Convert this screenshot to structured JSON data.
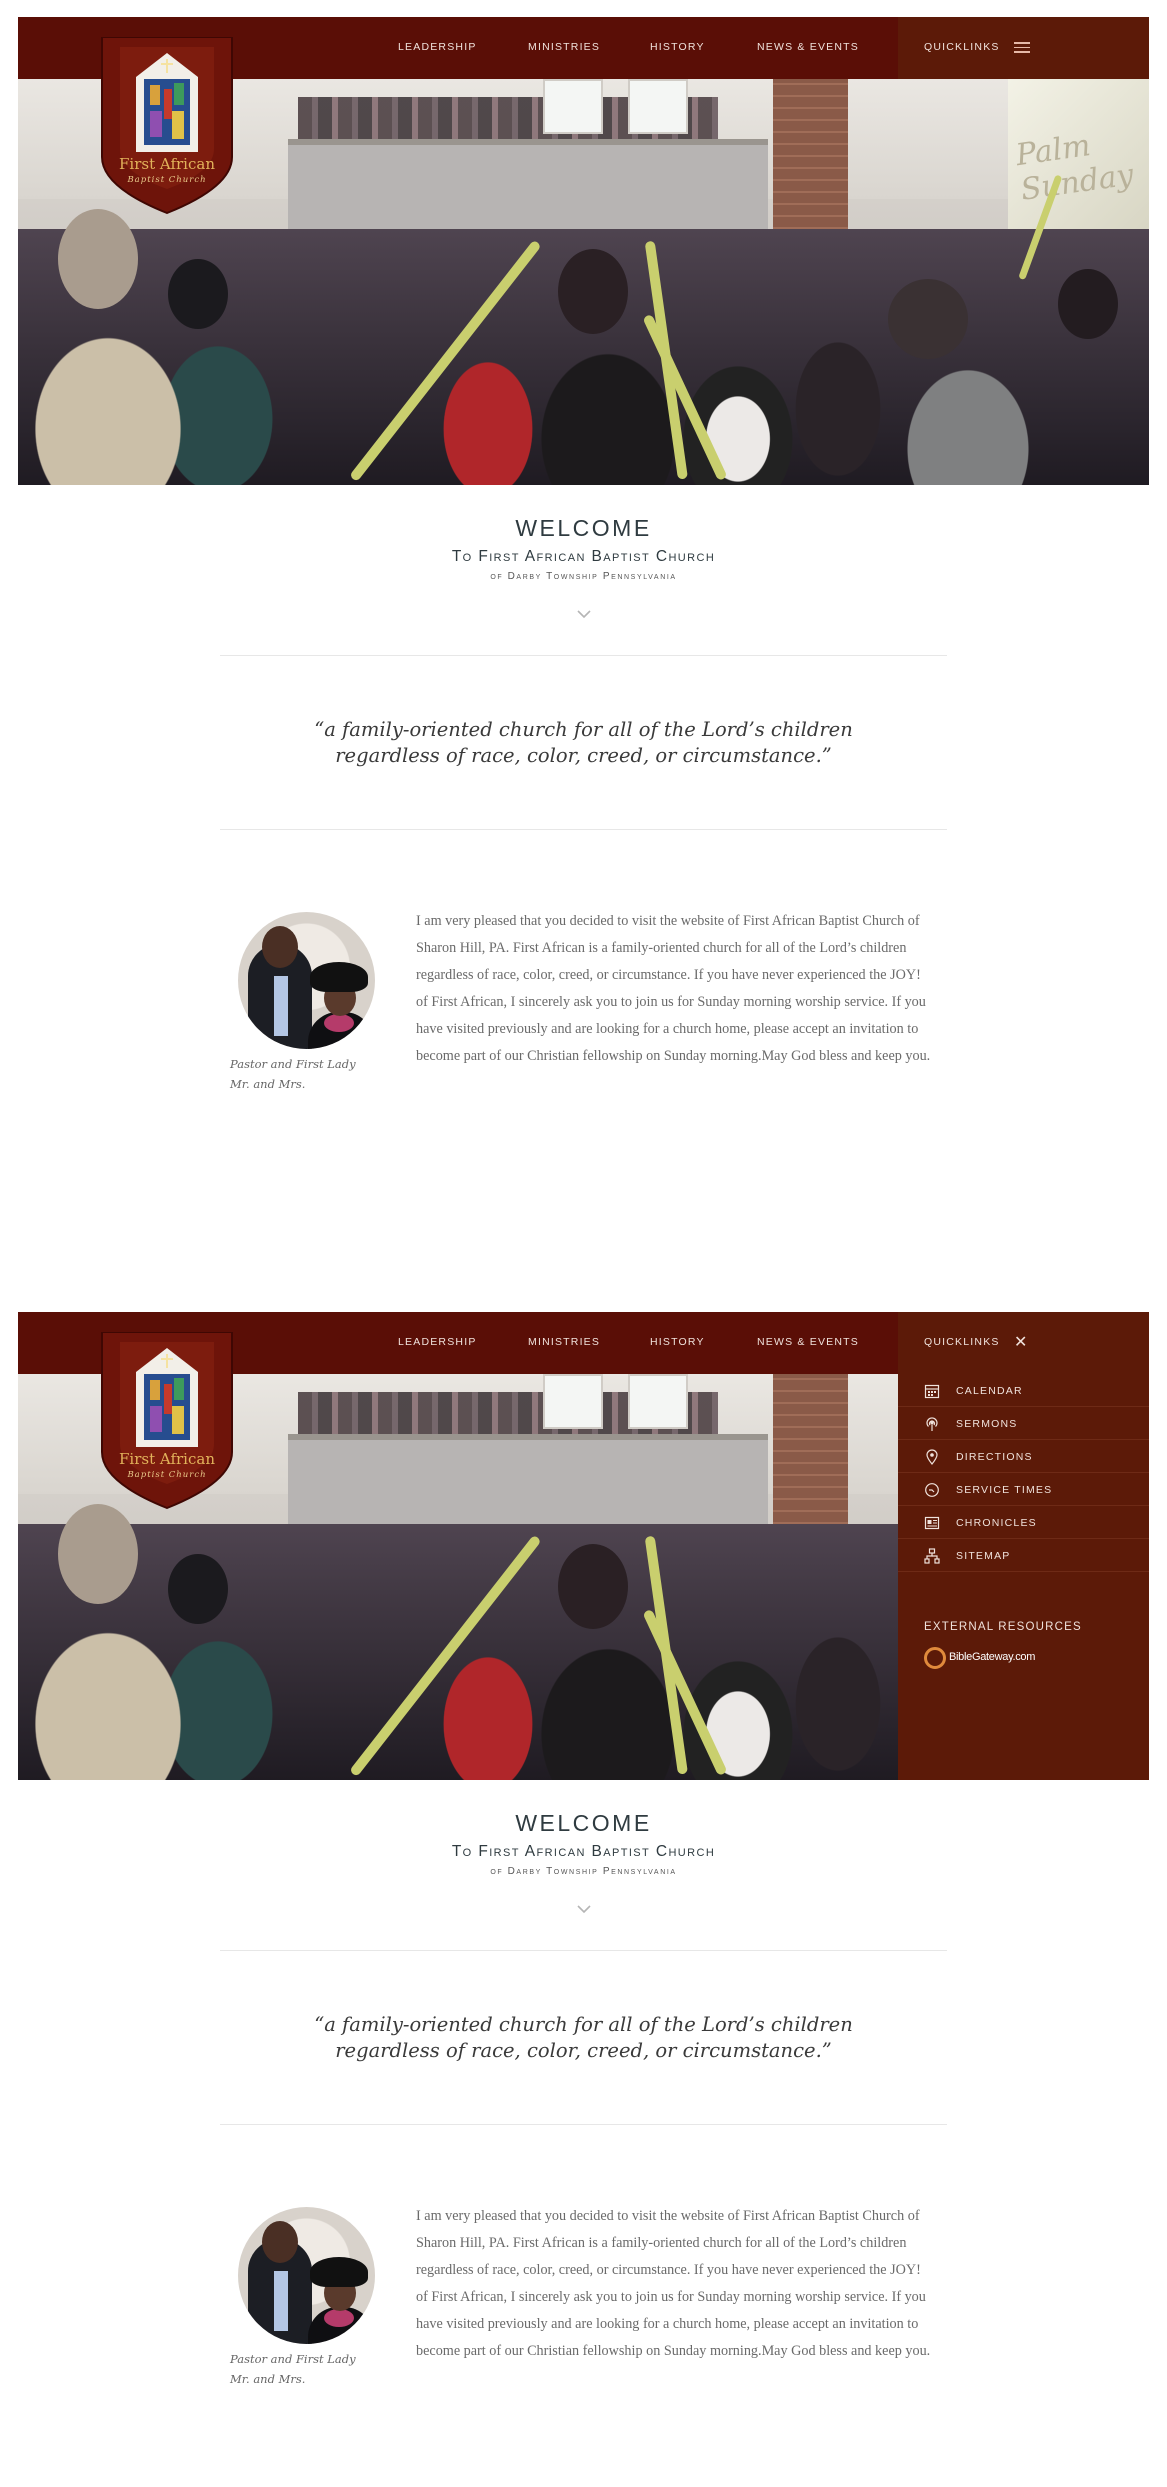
{
  "nav": {
    "items": [
      "LEADERSHIP",
      "MINISTRIES",
      "HISTORY",
      "NEWS & EVENTS"
    ],
    "quicklinks_label": "QUICKLINKS"
  },
  "logo": {
    "line1": "First African",
    "line2": "Baptist Church"
  },
  "hero": {
    "screen_text": "Palm Sunday"
  },
  "quicklinks_menu": {
    "items": [
      {
        "label": "CALENDAR",
        "icon": "calendar-icon"
      },
      {
        "label": "SERMONS",
        "icon": "broadcast-icon"
      },
      {
        "label": "DIRECTIONS",
        "icon": "map-pin-icon"
      },
      {
        "label": "SERVICE TIMES",
        "icon": "clock-icon"
      },
      {
        "label": "CHRONICLES",
        "icon": "newspaper-icon"
      },
      {
        "label": "SITEMAP",
        "icon": "sitemap-icon"
      }
    ],
    "external_title": "EXTERNAL RESOURCES",
    "external_links": [
      {
        "label": "BibleGateway.com"
      }
    ]
  },
  "welcome": {
    "title": "Welcome",
    "subtitle": "To First African Baptist Church",
    "location": "of Darby Township Pennsylvania"
  },
  "motto": {
    "line1": "“a family-oriented church for all of the Lord’s children",
    "line2": "regardless of race, color, creed, or circumstance.”"
  },
  "pastor": {
    "caption_line1": "Pastor and First Lady",
    "caption_line2": "Mr. and Mrs.",
    "message": "I am very pleased that you decided to visit the website of First African Baptist Church of Sharon Hill, PA. First African is a family-oriented church for all of the Lord’s children regardless of race, color, creed, or circumstance. If you have never experienced the JOY! of First African, I sincerely ask you to join us for Sunday morning worship service. If you have visited previously and are looking for a church home, please accept an invitation to become part of our Christian fellowship on Sunday morning.May God bless and keep you."
  },
  "colors": {
    "nav_bg": "#5a0e06",
    "drawer_bg": "#5c1a08",
    "heading": "#2f3b40",
    "gold": "#e2b35b"
  }
}
